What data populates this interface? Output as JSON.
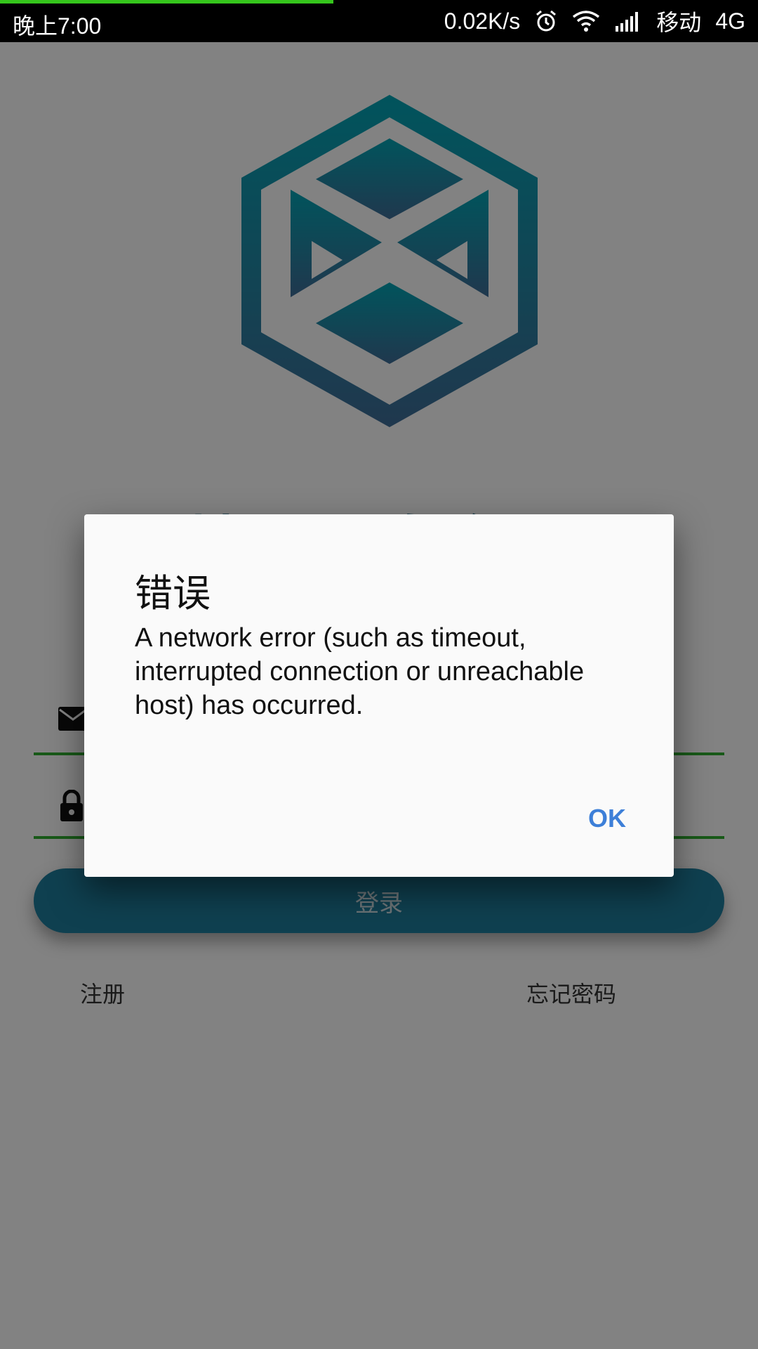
{
  "status_bar": {
    "time": "晚上7:00",
    "speed": "0.02K/s",
    "carrier": "移动",
    "network": "4G",
    "progress_percent": 44,
    "icons": [
      "alarm-icon",
      "wifi-icon",
      "signal-icon"
    ]
  },
  "login": {
    "app_title": "精灵证券盒子",
    "email_icon": "mail-icon",
    "password_icon": "lock-icon",
    "login_label": "登录",
    "register_label": "注册",
    "forgot_label": "忘记密码",
    "accent_color": "#1f7e9e",
    "underline_color": "#2fae2f"
  },
  "dialog": {
    "title": "错误",
    "message": "A network error (such as timeout, interrupted connection or unreachable host) has occurred.",
    "ok_label": "OK",
    "ok_color": "#3d7fd8"
  }
}
